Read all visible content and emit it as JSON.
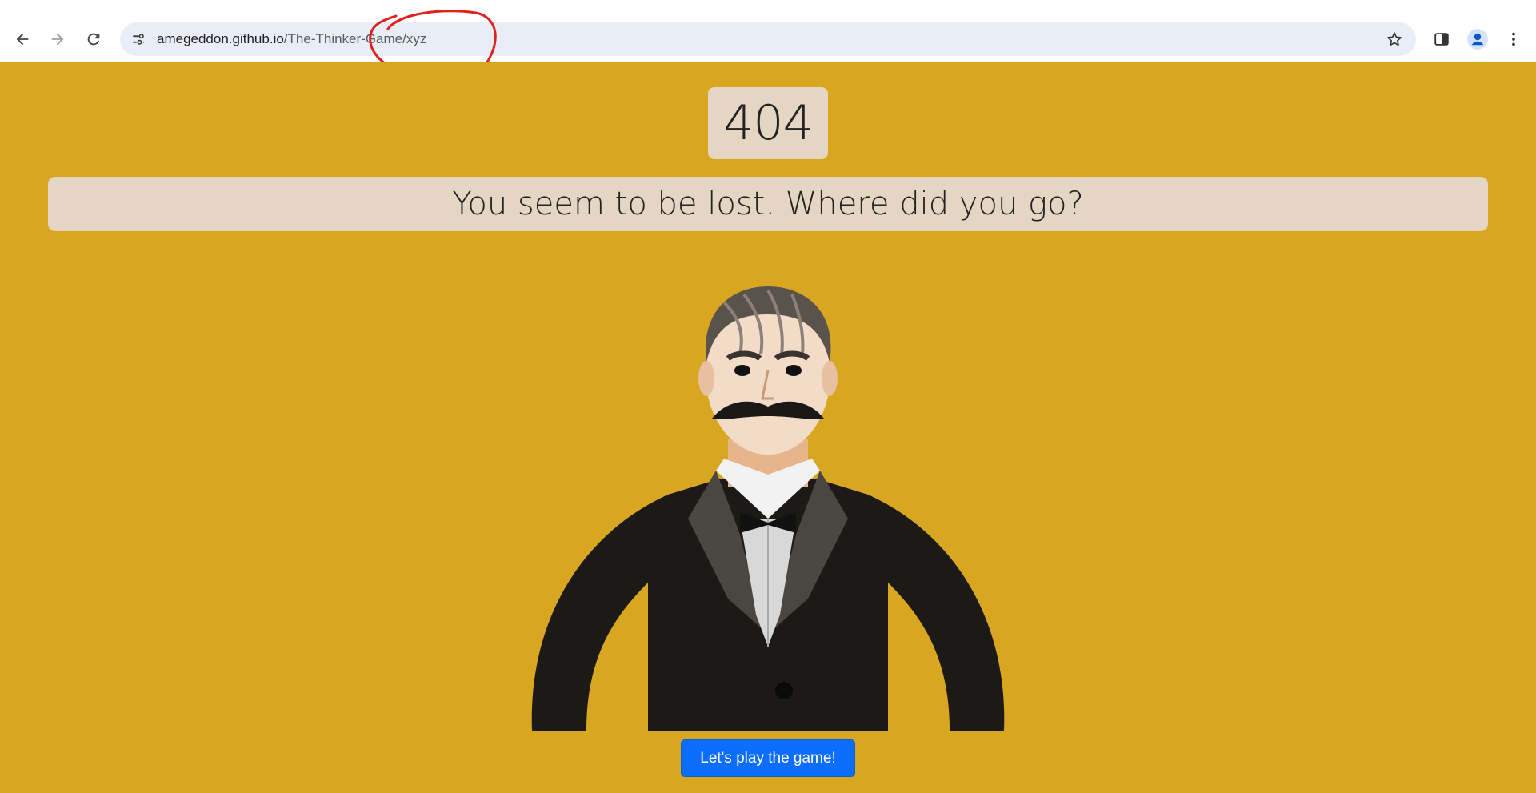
{
  "browser": {
    "url_host": "amegeddon.github.io",
    "url_path": "/The-Thinker-Game/xyz",
    "icons": {
      "back": "arrow-left-icon",
      "forward": "arrow-right-icon",
      "reload": "reload-icon",
      "site_info": "tune-icon",
      "bookmark": "star-icon",
      "side_panel": "side-panel-icon",
      "profile": "account-icon",
      "menu": "kebab-menu-icon"
    },
    "annotation_color": "#e0201b"
  },
  "page": {
    "background": "#d9a621",
    "error_code": "404",
    "message": "You seem to be lost. Where did you go?",
    "cta_label": "Let's play the game!",
    "cta_color": "#0d6efd"
  }
}
